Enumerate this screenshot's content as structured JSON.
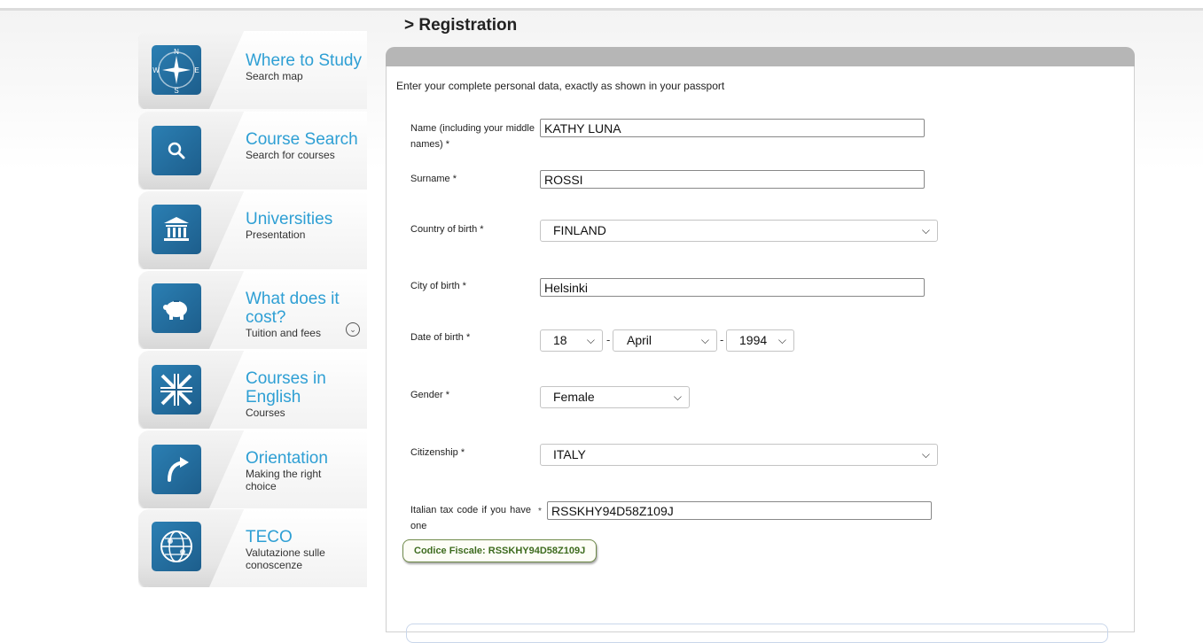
{
  "sidebar": {
    "items": [
      {
        "title": "Where to Study",
        "subtitle": "Search map",
        "icon": "compass-icon"
      },
      {
        "title": "Course Search",
        "subtitle": "Search for courses",
        "icon": "search-icon"
      },
      {
        "title": "Universities",
        "subtitle": "Presentation",
        "icon": "university-building-icon"
      },
      {
        "title": "What does it cost?",
        "subtitle": "Tuition and fees",
        "icon": "piggy-bank-icon"
      },
      {
        "title": "Courses in English",
        "subtitle": "Courses",
        "icon": "union-jack-flag-icon"
      },
      {
        "title": "Orientation",
        "subtitle": "Making the right choice",
        "icon": "arrow-turn-icon"
      },
      {
        "title": "TECO",
        "subtitle": "Valutazione sulle conoscenze",
        "icon": "globe-icon"
      }
    ],
    "compass_letters": {
      "n": "N",
      "s": "S",
      "w": "W",
      "e": "E"
    }
  },
  "page": {
    "heading": "> Registration",
    "intro": "Enter your complete personal data, exactly as shown in your passport"
  },
  "form": {
    "name_label": "Name (including your middle names) *",
    "name_value": "KATHY LUNA",
    "surname_label": "Surname *",
    "surname_value": "ROSSI",
    "country_label": "Country of birth *",
    "country_value": "FINLAND",
    "city_label": "City of birth *",
    "city_value": "Helsinki",
    "dob_label": "Date of birth *",
    "dob_day": "18",
    "dob_month": "April",
    "dob_year": "1994",
    "dob_separator": "-",
    "gender_label": "Gender *",
    "gender_value": "Female",
    "citizenship_label": "Citizenship *",
    "citizenship_value": "ITALY",
    "taxcode_label": "Italian tax code if you have one",
    "taxcode_required_mark": "*",
    "taxcode_value": "RSSKHY94D58Z109J",
    "codice_fiscale_badge": "Codice Fiscale: RSSKHY94D58Z109J"
  },
  "colors": {
    "accent": "#2e9fd4",
    "icon_bg": "#1d5e8c",
    "badge_text": "#3d6b1e",
    "panel_bar": "#b6b6b6"
  }
}
